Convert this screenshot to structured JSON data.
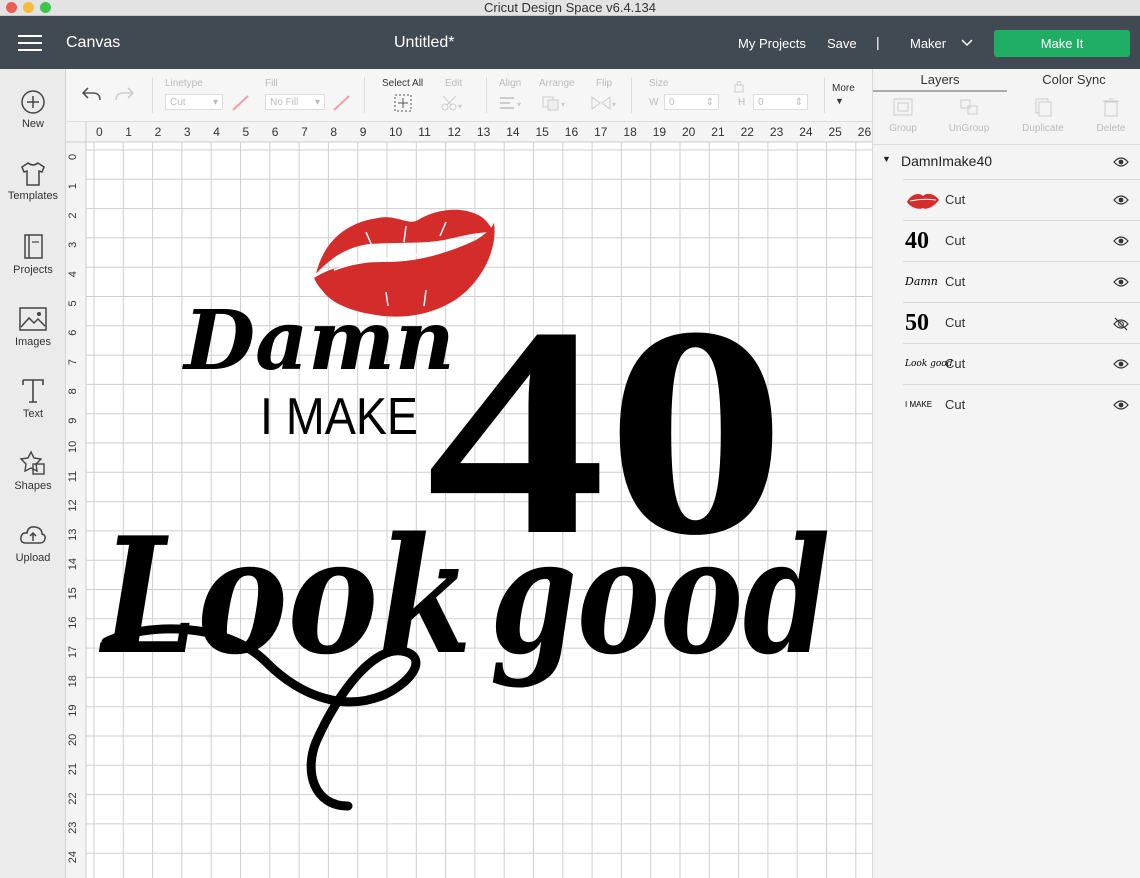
{
  "window": {
    "title": "Cricut Design Space  v6.4.134"
  },
  "header": {
    "canvas_label": "Canvas",
    "project_title": "Untitled*",
    "my_projects": "My Projects",
    "save": "Save",
    "separator": "|",
    "machine": "Maker",
    "make_it": "Make It",
    "accent_color": "#1fae64"
  },
  "leftbar": {
    "items": [
      {
        "label": "New",
        "icon": "plus-circle-icon"
      },
      {
        "label": "Templates",
        "icon": "tshirt-icon"
      },
      {
        "label": "Projects",
        "icon": "book-icon"
      },
      {
        "label": "Images",
        "icon": "image-icon"
      },
      {
        "label": "Text",
        "icon": "text-icon"
      },
      {
        "label": "Shapes",
        "icon": "shapes-icon"
      },
      {
        "label": "Upload",
        "icon": "cloud-upload-icon"
      }
    ]
  },
  "toolbar": {
    "linetype_label": "Linetype",
    "linetype_value": "Cut",
    "fill_label": "Fill",
    "fill_value": "No Fill",
    "select_all": "Select All",
    "edit": "Edit",
    "align": "Align",
    "arrange": "Arrange",
    "flip": "Flip",
    "size": "Size",
    "w_label": "W",
    "w_value": "0",
    "h_label": "H",
    "h_value": "0",
    "more": "More"
  },
  "ruler": {
    "top": [
      "0",
      "1",
      "2",
      "3",
      "4",
      "5",
      "6",
      "7",
      "8",
      "9",
      "10",
      "11",
      "12",
      "13",
      "14",
      "15",
      "16",
      "17",
      "18",
      "19",
      "20",
      "21",
      "22",
      "23",
      "24",
      "25",
      "26"
    ],
    "left": [
      "0",
      "1",
      "2",
      "3",
      "4",
      "5",
      "6",
      "7",
      "8",
      "9",
      "10",
      "11",
      "12",
      "13",
      "14",
      "15",
      "16",
      "17",
      "18",
      "19",
      "20",
      "21",
      "22",
      "23",
      "24"
    ]
  },
  "design": {
    "damn": "Damn",
    "i_make": "I MAKE",
    "forty": "40",
    "look": "Look",
    "good": "good",
    "lips_color": "#d42b2b"
  },
  "panel": {
    "tabs": [
      "Layers",
      "Color Sync"
    ],
    "actions": [
      "Group",
      "UnGroup",
      "Duplicate",
      "Delete"
    ],
    "group_name": "DamnImake40",
    "layers": [
      {
        "thumb": "lips",
        "label": "Cut",
        "visible": true
      },
      {
        "thumb": "40",
        "label": "Cut",
        "visible": true
      },
      {
        "thumb": "Damn",
        "label": "Cut",
        "visible": true
      },
      {
        "thumb": "50",
        "label": "Cut",
        "visible": false
      },
      {
        "thumb": "Look good",
        "label": "Cut",
        "visible": true
      },
      {
        "thumb": "I MAKE",
        "label": "Cut",
        "visible": true
      }
    ]
  }
}
